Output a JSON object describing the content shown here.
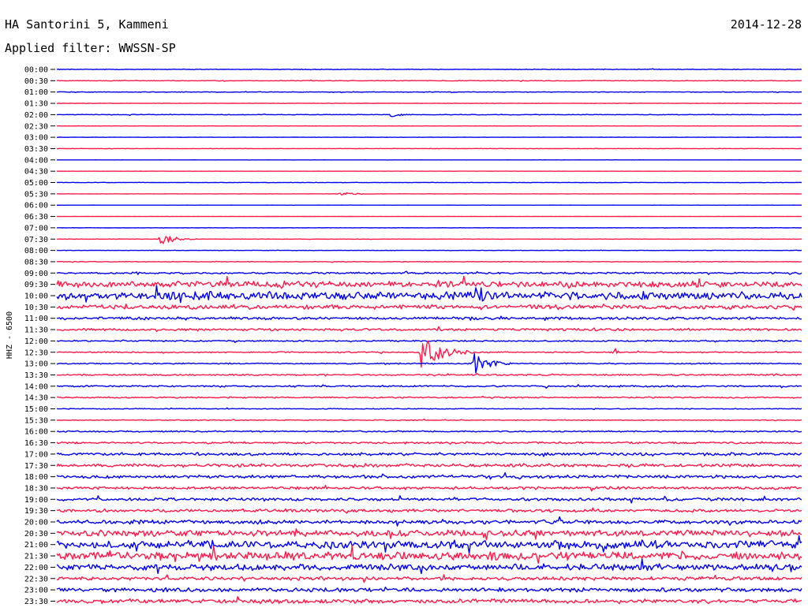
{
  "header": {
    "station": "HA Santorini 5, Kammeni",
    "filter": "Applied filter: WWSSN-SP",
    "date": "2014-12-28"
  },
  "chart_data": {
    "type": "line",
    "title": "HA Santorini 5, Kammeni",
    "subtitle": "Applied filter: WWSSN-SP",
    "date": "2014-12-28",
    "ylabel": "HHZ - 6500",
    "tick_labels": [
      "00:00",
      "00:30",
      "01:00",
      "01:30",
      "02:00",
      "02:30",
      "03:00",
      "03:30",
      "04:00",
      "04:30",
      "05:00",
      "05:30",
      "06:00",
      "06:30",
      "07:00",
      "07:30",
      "08:00",
      "08:30",
      "09:00",
      "09:30",
      "10:00",
      "10:30",
      "11:00",
      "11:30",
      "12:00",
      "12:30",
      "13:00",
      "13:30",
      "14:00",
      "14:30",
      "15:00",
      "15:30",
      "16:00",
      "16:30",
      "17:00",
      "17:30",
      "18:00",
      "18:30",
      "19:00",
      "19:30",
      "20:00",
      "20:30",
      "21:00",
      "21:30",
      "22:00",
      "22:30",
      "23:00",
      "23:30"
    ],
    "colors": [
      "#0000ee",
      "#ff1a4a"
    ],
    "noise_level": [
      0.3,
      0.3,
      0.3,
      0.2,
      0.3,
      0.1,
      0.1,
      0.2,
      0.05,
      0.05,
      0.2,
      0.1,
      0.05,
      0.05,
      0.15,
      0.15,
      0.2,
      0.3,
      0.9,
      3.2,
      4.2,
      2.2,
      1.4,
      1.2,
      0.7,
      0.6,
      0.6,
      0.7,
      0.8,
      0.7,
      0.4,
      0.4,
      0.7,
      1.0,
      1.5,
      1.7,
      1.6,
      1.4,
      1.5,
      1.6,
      2.0,
      3.2,
      4.2,
      4.2,
      3.2,
      1.8,
      2.0,
      2.2
    ],
    "events": [
      {
        "line": 15,
        "time_frac": 0.14,
        "amplitude": 8,
        "duration_frac": 0.05
      },
      {
        "line": 11,
        "time_frac": 0.38,
        "amplitude": 2,
        "duration_frac": 0.06
      },
      {
        "line": 4,
        "time_frac": 0.45,
        "amplitude": 3,
        "duration_frac": 0.03
      },
      {
        "line": 25,
        "time_frac": 0.49,
        "amplitude": 22,
        "duration_frac": 0.07
      },
      {
        "line": 26,
        "time_frac": 0.56,
        "amplitude": 14,
        "duration_frac": 0.05
      },
      {
        "line": 25,
        "time_frac": 0.75,
        "amplitude": 5,
        "duration_frac": 0.01
      },
      {
        "line": 20,
        "time_frac": 0.57,
        "amplitude": 10,
        "duration_frac": 0.02
      }
    ]
  }
}
